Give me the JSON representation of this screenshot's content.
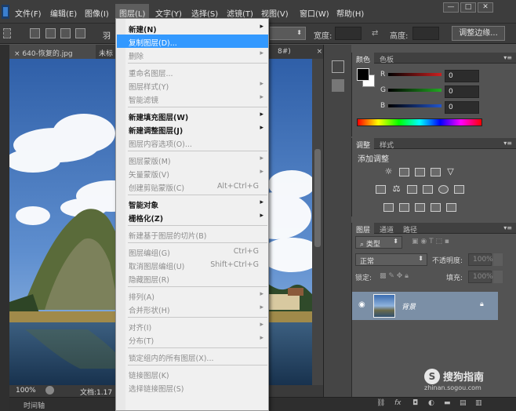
{
  "menubar": {
    "items": [
      "文件(F)",
      "编辑(E)",
      "图像(I)",
      "图层(L)",
      "文字(Y)",
      "选择(S)",
      "滤镜(T)",
      "视图(V)",
      "窗口(W)",
      "帮助(H)"
    ],
    "window_buttons": [
      "—",
      "□",
      "✕"
    ]
  },
  "options_bar": {
    "feather_label": "羽",
    "width_label": "宽度:",
    "height_label": "高度:",
    "refine_edge_button": "调整边缘..."
  },
  "document_tabs": [
    {
      "label": "640-恢复的.jpg",
      "close": "×"
    },
    {
      "label": "未标",
      "close": ""
    },
    {
      "label": "8#)",
      "close": "×"
    }
  ],
  "status_bar": {
    "zoom": "100%",
    "doc_info": "文档:1.17"
  },
  "timeline_label": "时间轴",
  "color_panel": {
    "tabs": [
      "颜色",
      "色板"
    ],
    "channels": [
      {
        "label": "R",
        "value": "0",
        "color": "#cc2020"
      },
      {
        "label": "G",
        "value": "0",
        "color": "#22aa22"
      },
      {
        "label": "B",
        "value": "0",
        "color": "#2255cc"
      }
    ]
  },
  "adjustments_panel": {
    "tabs": [
      "调整",
      "样式"
    ],
    "title": "添加调整"
  },
  "layers_panel": {
    "tabs": [
      "图层",
      "通道",
      "路径"
    ],
    "filter_kind": "类型",
    "blend_mode": "正常",
    "opacity_label": "不透明度:",
    "opacity_value": "100%",
    "lock_label": "锁定:",
    "fill_label": "填充:",
    "fill_value": "100%",
    "layers": [
      {
        "name": "背景",
        "visible": true,
        "locked": true
      }
    ],
    "footer_icons": [
      "link-icon",
      "fx-icon",
      "mask-icon",
      "adjustment-icon",
      "folder-icon",
      "new-layer-icon",
      "trash-icon"
    ]
  },
  "layer_menu": {
    "items": [
      {
        "label": "新建(N)",
        "shortcut": "",
        "submenu": true,
        "disabled": false,
        "bold": true
      },
      {
        "label": "复制图层(D)...",
        "shortcut": "",
        "submenu": false,
        "disabled": false,
        "bold": false,
        "highlighted": true
      },
      {
        "label": "删除",
        "shortcut": "",
        "submenu": true,
        "disabled": true,
        "bold": false
      },
      {
        "separator": true
      },
      {
        "label": "重命名图层...",
        "shortcut": "",
        "submenu": false,
        "disabled": true,
        "bold": false
      },
      {
        "label": "图层样式(Y)",
        "shortcut": "",
        "submenu": true,
        "disabled": true,
        "bold": false
      },
      {
        "label": "智能滤镜",
        "shortcut": "",
        "submenu": true,
        "disabled": true,
        "bold": false
      },
      {
        "separator": true
      },
      {
        "label": "新建填充图层(W)",
        "shortcut": "",
        "submenu": true,
        "disabled": false,
        "bold": true
      },
      {
        "label": "新建调整图层(J)",
        "shortcut": "",
        "submenu": true,
        "disabled": false,
        "bold": true
      },
      {
        "label": "图层内容选项(O)...",
        "shortcut": "",
        "submenu": false,
        "disabled": true,
        "bold": false
      },
      {
        "separator": true
      },
      {
        "label": "图层蒙版(M)",
        "shortcut": "",
        "submenu": true,
        "disabled": true,
        "bold": false
      },
      {
        "label": "矢量蒙版(V)",
        "shortcut": "",
        "submenu": true,
        "disabled": true,
        "bold": false
      },
      {
        "label": "创建剪贴蒙版(C)",
        "shortcut": "Alt+Ctrl+G",
        "submenu": false,
        "disabled": true,
        "bold": false
      },
      {
        "separator": true
      },
      {
        "label": "智能对象",
        "shortcut": "",
        "submenu": true,
        "disabled": false,
        "bold": true
      },
      {
        "label": "栅格化(Z)",
        "shortcut": "",
        "submenu": true,
        "disabled": false,
        "bold": true
      },
      {
        "separator": true
      },
      {
        "label": "新建基于图层的切片(B)",
        "shortcut": "",
        "submenu": false,
        "disabled": true,
        "bold": false
      },
      {
        "separator": true
      },
      {
        "label": "图层编组(G)",
        "shortcut": "Ctrl+G",
        "submenu": false,
        "disabled": true,
        "bold": false
      },
      {
        "label": "取消图层编组(U)",
        "shortcut": "Shift+Ctrl+G",
        "submenu": false,
        "disabled": true,
        "bold": false
      },
      {
        "label": "隐藏图层(R)",
        "shortcut": "",
        "submenu": false,
        "disabled": true,
        "bold": false
      },
      {
        "separator": true
      },
      {
        "label": "排列(A)",
        "shortcut": "",
        "submenu": true,
        "disabled": true,
        "bold": false
      },
      {
        "label": "合并形状(H)",
        "shortcut": "",
        "submenu": true,
        "disabled": true,
        "bold": false
      },
      {
        "separator": true
      },
      {
        "label": "对齐(I)",
        "shortcut": "",
        "submenu": true,
        "disabled": true,
        "bold": false
      },
      {
        "label": "分布(T)",
        "shortcut": "",
        "submenu": true,
        "disabled": true,
        "bold": false
      },
      {
        "separator": true
      },
      {
        "label": "锁定组内的所有图层(X)...",
        "shortcut": "",
        "submenu": false,
        "disabled": true,
        "bold": false
      },
      {
        "separator": true
      },
      {
        "label": "链接图层(K)",
        "shortcut": "",
        "submenu": false,
        "disabled": true,
        "bold": false
      },
      {
        "label": "选择链接图层(S)",
        "shortcut": "",
        "submenu": false,
        "disabled": true,
        "bold": false
      }
    ]
  },
  "watermark": {
    "brand": "搜狗指南",
    "logo_letter": "S",
    "url": "zhinan.sogou.com"
  }
}
